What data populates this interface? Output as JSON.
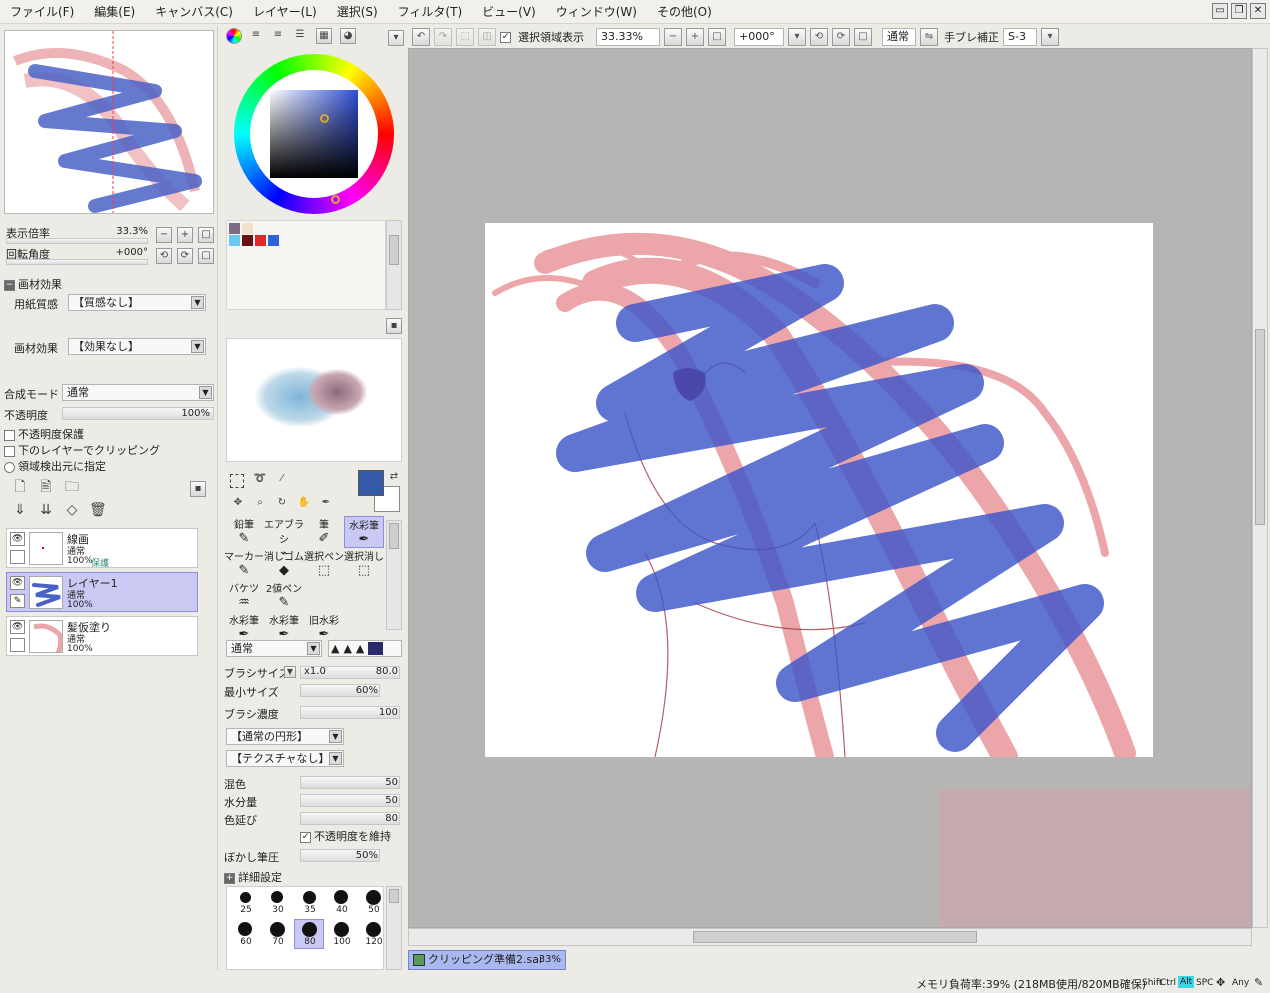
{
  "menu": {
    "items": [
      "ファイル(F)",
      "編集(E)",
      "キャンバス(C)",
      "レイヤー(L)",
      "選択(S)",
      "フィルタ(T)",
      "ビュー(V)",
      "ウィンドウ(W)",
      "その他(O)"
    ],
    "window_buttons": [
      "▭",
      "❐",
      "✕"
    ]
  },
  "toolbar": {
    "selection_display": "選択領域表示",
    "zoom": "33.33%",
    "rotation": "+000°",
    "blend": "通常",
    "stabilizer_label": "手ブレ補正",
    "stabilizer_value": "S-3"
  },
  "navigator": {
    "zoom_label": "表示倍率",
    "zoom_value": "33.3%",
    "angle_label": "回転角度",
    "angle_value": "+000°"
  },
  "material": {
    "header": "画材効果",
    "paper_label": "用紙質感",
    "paper_value": "【質感なし】",
    "effect_label": "画材効果",
    "effect_value": "【効果なし】"
  },
  "layer_props": {
    "blend_label": "合成モード",
    "blend_value": "通常",
    "opacity_label": "不透明度",
    "opacity_value": "100%",
    "protect_opacity": "不透明度保護",
    "clip_lower": "下のレイヤーでクリッピング",
    "selection_source": "領域検出元に指定"
  },
  "layers": [
    {
      "name": "線画",
      "mode": "通常",
      "opacity": "100%",
      "extra": "保護"
    },
    {
      "name": "レイヤー1",
      "mode": "通常",
      "opacity": "100%",
      "extra": ""
    },
    {
      "name": "髪仮塗り",
      "mode": "通常",
      "opacity": "100%",
      "extra": ""
    }
  ],
  "palette": {
    "colors": [
      "#7d6b8a",
      "#f2e0c8",
      "#6bc8ef",
      "#6b1010",
      "#e02a2a",
      "#2d63d6"
    ]
  },
  "tools": {
    "main_color": "#3559a6",
    "sub_color": "#ffffff",
    "brush_tools": [
      {
        "label": "鉛筆",
        "icon": "pencil-icon"
      },
      {
        "label": "エアブラシ",
        "icon": "airbrush-icon"
      },
      {
        "label": "筆",
        "icon": "brush-icon"
      },
      {
        "label": "水彩筆",
        "icon": "watercolor-icon"
      },
      {
        "label": "マーカー",
        "icon": "marker-icon"
      },
      {
        "label": "消しゴム",
        "icon": "eraser-icon"
      },
      {
        "label": "選択ペン",
        "icon": "select-pen-icon"
      },
      {
        "label": "選択消し",
        "icon": "select-erase-icon"
      },
      {
        "label": "バケツ",
        "icon": "bucket-icon"
      },
      {
        "label": "2値ペン",
        "icon": "binary-pen-icon"
      },
      {
        "label": "",
        "icon": ""
      },
      {
        "label": "",
        "icon": ""
      },
      {
        "label": "水彩筆",
        "icon": "watercolor-icon"
      },
      {
        "label": "水彩筆",
        "icon": "watercolor-icon"
      },
      {
        "label": "旧水彩",
        "icon": "old-watercolor-icon"
      },
      {
        "label": "",
        "icon": ""
      }
    ]
  },
  "brush": {
    "mode": "通常",
    "size_label": "ブラシサイズ",
    "size_mult": "x1.0",
    "size_value": "80.0",
    "min_size_label": "最小サイズ",
    "min_size_value": "60%",
    "density_label": "ブラシ濃度",
    "density_value": "100",
    "shape": "【通常の円形】",
    "texture": "【テクスチャなし】",
    "blend_label": "混色",
    "blend_value": "50",
    "water_label": "水分量",
    "water_value": "50",
    "stretch_label": "色延び",
    "stretch_value": "80",
    "keep_opacity": "不透明度を維持",
    "blur_label": "ぼかし筆圧",
    "blur_value": "50%",
    "advanced": "詳細設定",
    "sizes": [
      "25",
      "30",
      "35",
      "40",
      "50",
      "60",
      "70",
      "80",
      "100",
      "120"
    ]
  },
  "document": {
    "tab": "クリッピング準備2.sai",
    "zoom": "33%"
  },
  "status": {
    "memory": "メモリ負荷率:39% (218MB使用/820MB確保)",
    "keys": [
      "Shift",
      "Ctrl",
      "Alt",
      "SPC",
      "Any"
    ]
  }
}
